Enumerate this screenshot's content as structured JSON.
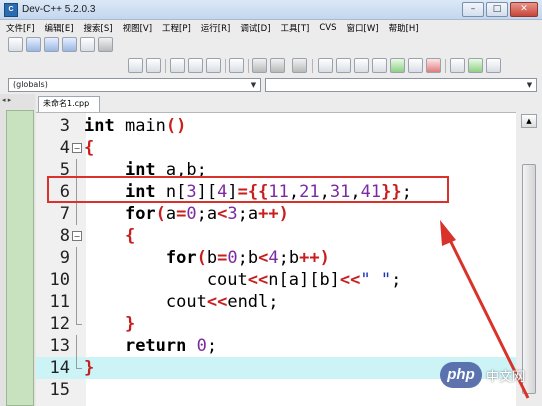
{
  "window": {
    "title": "Dev-C++ 5.2.0.3",
    "app_icon": "dev-cpp-icon",
    "controls": {
      "minimize": "–",
      "maximize": "□",
      "close": "✕"
    }
  },
  "menu": [
    "文件[F]",
    "编辑[E]",
    "搜索[S]",
    "视图[V]",
    "工程[P]",
    "运行[R]",
    "调试[D]",
    "工具[T]",
    "CVS",
    "窗口[W]",
    "帮助[H]"
  ],
  "scope": {
    "globals": "(globals)",
    "member": ""
  },
  "panel": {
    "nav": "◂ ▸"
  },
  "editor": {
    "tab_label": "未命名1.cpp",
    "lines": [
      {
        "num": "3",
        "fold": "",
        "text": "int main()"
      },
      {
        "num": "4",
        "fold": "box",
        "text": "{"
      },
      {
        "num": "5",
        "fold": "line",
        "text": "    int a,b;"
      },
      {
        "num": "6",
        "fold": "line",
        "text": "    int n[3][4]={{11,21,31,41}};"
      },
      {
        "num": "7",
        "fold": "line",
        "text": "    for(a=0;a<3;a++)"
      },
      {
        "num": "8",
        "fold": "box",
        "text": "    {"
      },
      {
        "num": "9",
        "fold": "line",
        "text": "        for(b=0;b<4;b++)"
      },
      {
        "num": "10",
        "fold": "line",
        "text": "            cout<<n[a][b]<<\" \";"
      },
      {
        "num": "11",
        "fold": "line",
        "text": "        cout<<endl;"
      },
      {
        "num": "12",
        "fold": "end",
        "text": "    }"
      },
      {
        "num": "13",
        "fold": "line",
        "text": "    return 0;"
      },
      {
        "num": "14",
        "fold": "end",
        "text": "}"
      },
      {
        "num": "15",
        "fold": "",
        "text": ""
      }
    ],
    "active_line": "14"
  },
  "colors": {
    "keyword": "#000000",
    "symbol": "#c81e1e",
    "number": "#7b2aa3",
    "string": "#1a32b8",
    "active_line_bg": "#ccf4f7",
    "annotation": "#d9322a"
  },
  "watermark": {
    "logo": "php",
    "text": "中文网"
  }
}
